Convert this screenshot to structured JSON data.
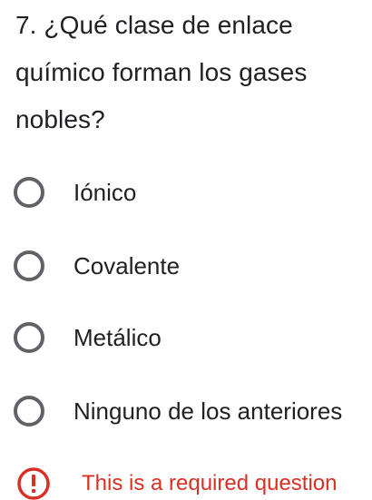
{
  "question": {
    "text": "7. ¿Qué clase de enlace químico forman los gases nobles?"
  },
  "options": [
    {
      "label": "Iónico",
      "selected": false
    },
    {
      "label": "Covalente",
      "selected": false
    },
    {
      "label": "Metálico",
      "selected": false
    },
    {
      "label": "Ninguno de los anteriores",
      "selected": false
    }
  ],
  "validation": {
    "message": "This is a required question",
    "icon": "alert-circle-icon",
    "color": "#d93025"
  },
  "colors": {
    "text": "#202124",
    "radio_border": "#5f6368",
    "error": "#d93025"
  }
}
